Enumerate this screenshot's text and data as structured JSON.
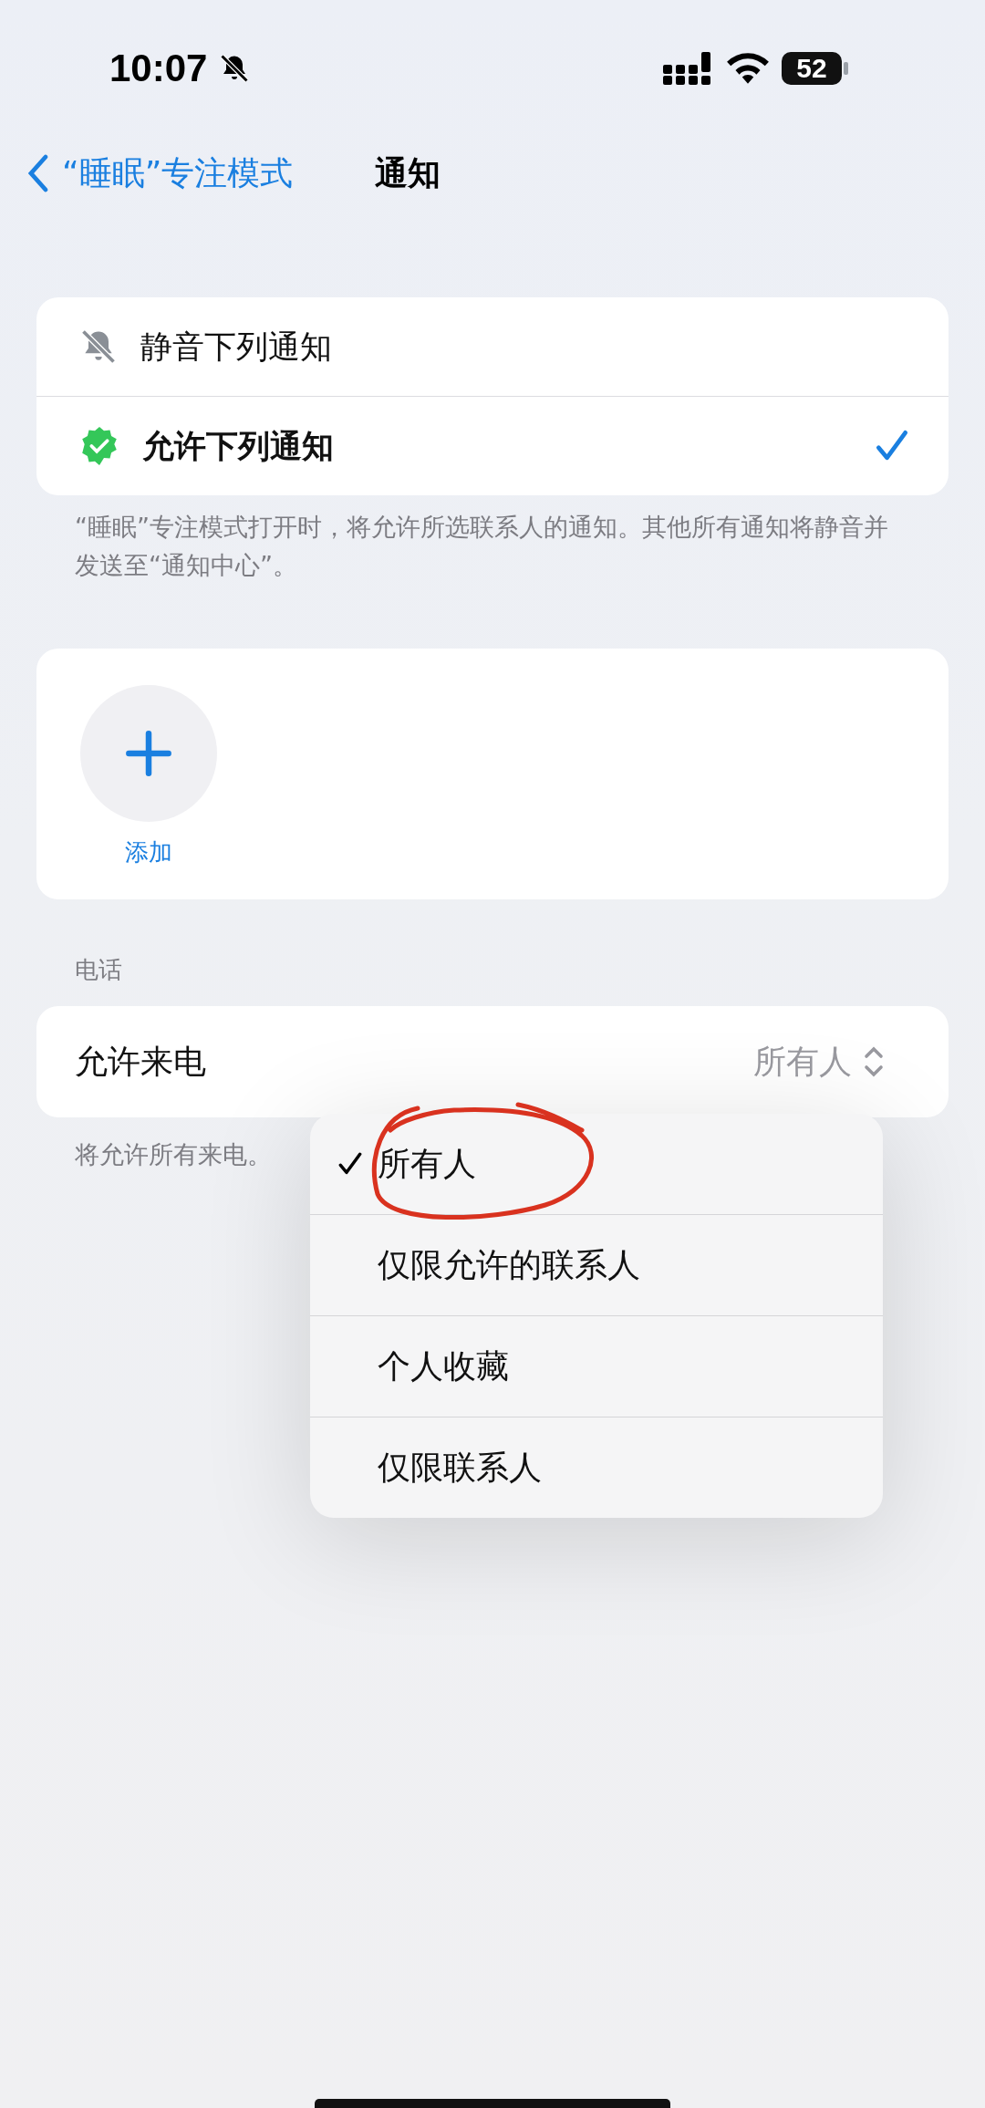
{
  "status_bar": {
    "time": "10:07",
    "silent": true,
    "battery": "52"
  },
  "nav": {
    "back": "“睡眠”专注模式",
    "title": "通知"
  },
  "mode_options": [
    {
      "label": "静音下列通知",
      "kind": "silence",
      "selected": false
    },
    {
      "label": "允许下列通知",
      "kind": "allow",
      "selected": true
    }
  ],
  "mode_footnote": "“睡眠”专注模式打开时，将允许所选联系人的通知。其他所有通知将静音并发送至“通知中心”。",
  "add_button": {
    "label": "添加"
  },
  "calls": {
    "header": "电话",
    "label": "允许来电",
    "value": "所有人",
    "footnote": "将允许所有来电。"
  },
  "menu": [
    {
      "label": "所有人",
      "selected": true
    },
    {
      "label": "仅限允许的联系人",
      "selected": false
    },
    {
      "label": "个人收藏",
      "selected": false
    },
    {
      "label": "仅限联系人",
      "selected": false
    }
  ],
  "annotation": {
    "kind": "circle"
  }
}
